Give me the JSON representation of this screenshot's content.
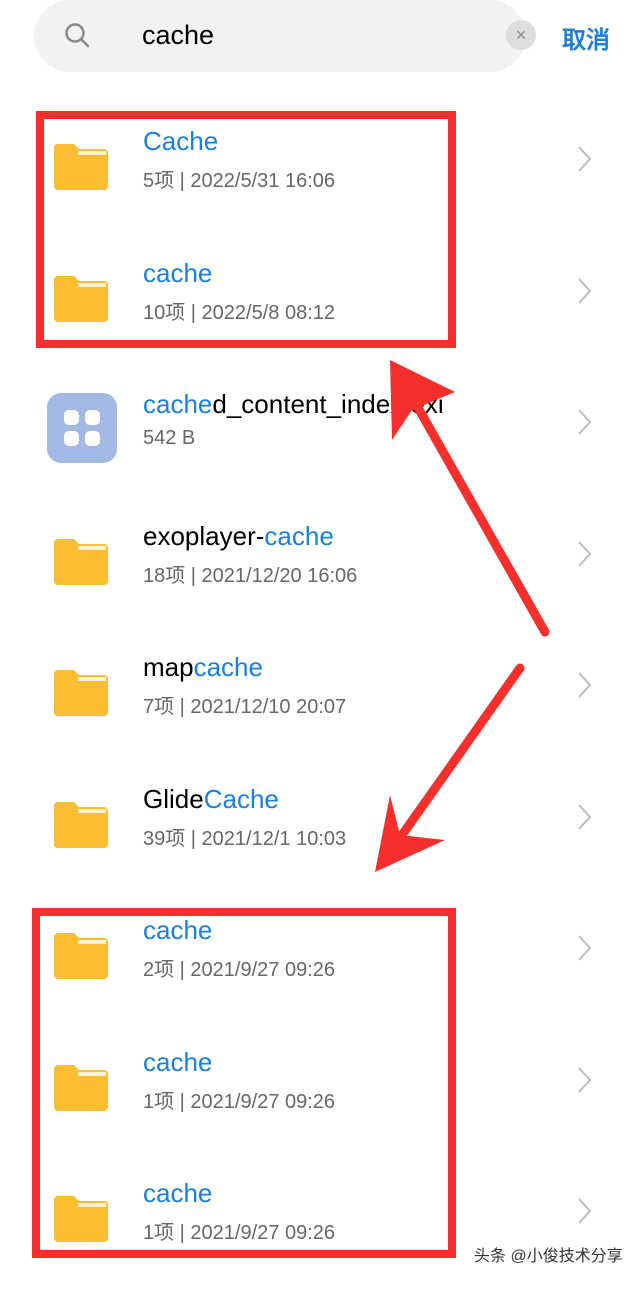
{
  "search": {
    "query": "cache",
    "icon": "search-icon",
    "clear_icon": "close-icon",
    "clear_glyph": "×"
  },
  "cancel_label": "取消",
  "colors": {
    "accent": "#1a7fe0",
    "folder": "#fbbd31",
    "annotation": "#f52f2b"
  },
  "items": [
    {
      "type": "folder",
      "pre": "",
      "hl": "Cache",
      "post": "",
      "meta": "5项 | 2022/5/31 16:06"
    },
    {
      "type": "folder",
      "pre": "",
      "hl": "cache",
      "post": "",
      "meta": "10项 | 2022/5/8 08:12"
    },
    {
      "type": "file",
      "pre": "",
      "hl": "cache",
      "post": "d_content_index.exi",
      "meta": "542 B"
    },
    {
      "type": "folder",
      "pre": "exoplayer-",
      "hl": "cache",
      "post": "",
      "meta": "18项 | 2021/12/20 16:06"
    },
    {
      "type": "folder",
      "pre": "map",
      "hl": "cache",
      "post": "",
      "meta": "7项 | 2021/12/10 20:07"
    },
    {
      "type": "folder",
      "pre": "Glide",
      "hl": "Cache",
      "post": "",
      "meta": "39项 | 2021/12/1 10:03"
    },
    {
      "type": "folder",
      "pre": "",
      "hl": "cache",
      "post": "",
      "meta": "2项 | 2021/9/27 09:26"
    },
    {
      "type": "folder",
      "pre": "",
      "hl": "cache",
      "post": "",
      "meta": "1项 | 2021/9/27 09:26"
    },
    {
      "type": "folder",
      "pre": "",
      "hl": "cache",
      "post": "",
      "meta": "1项 | 2021/9/27 09:26"
    }
  ],
  "watermark": "头条 @小俊技术分享"
}
